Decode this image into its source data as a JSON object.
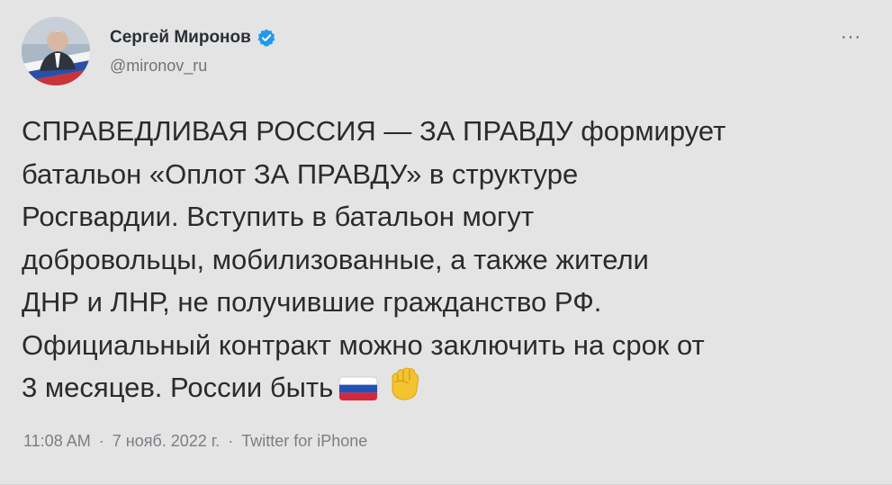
{
  "author": {
    "display_name": "Сергей Миронов",
    "handle": "@mironov_ru",
    "verified": true,
    "avatar_icon": "user-avatar-photo"
  },
  "more_label": "···",
  "tweet": {
    "text": "СПРАВЕДЛИВАЯ РОССИЯ — ЗА ПРАВДУ формирует\nбатальон «Оплот ЗА ПРАВДУ» в структуре\nРосгвардии. Вступить в батальон могут\nдобровольцы, мобилизованные, а также жители\nДНР и ЛНР, не получившие гражданство РФ.\nОфициальный контракт можно заключить на срок от\n3 месяцев. России быть",
    "emojis": [
      "russia-flag-icon",
      "raised-fist-icon"
    ]
  },
  "meta": {
    "time": "11:08 AM",
    "separator1": "·",
    "date": "7 нояб. 2022 г.",
    "separator2": "·",
    "source": "Twitter for iPhone"
  },
  "colors": {
    "background": "#e4e4e4",
    "verified_blue": "#1d9bf0",
    "text": "#2b2b2b",
    "muted": "#7a7e83"
  }
}
